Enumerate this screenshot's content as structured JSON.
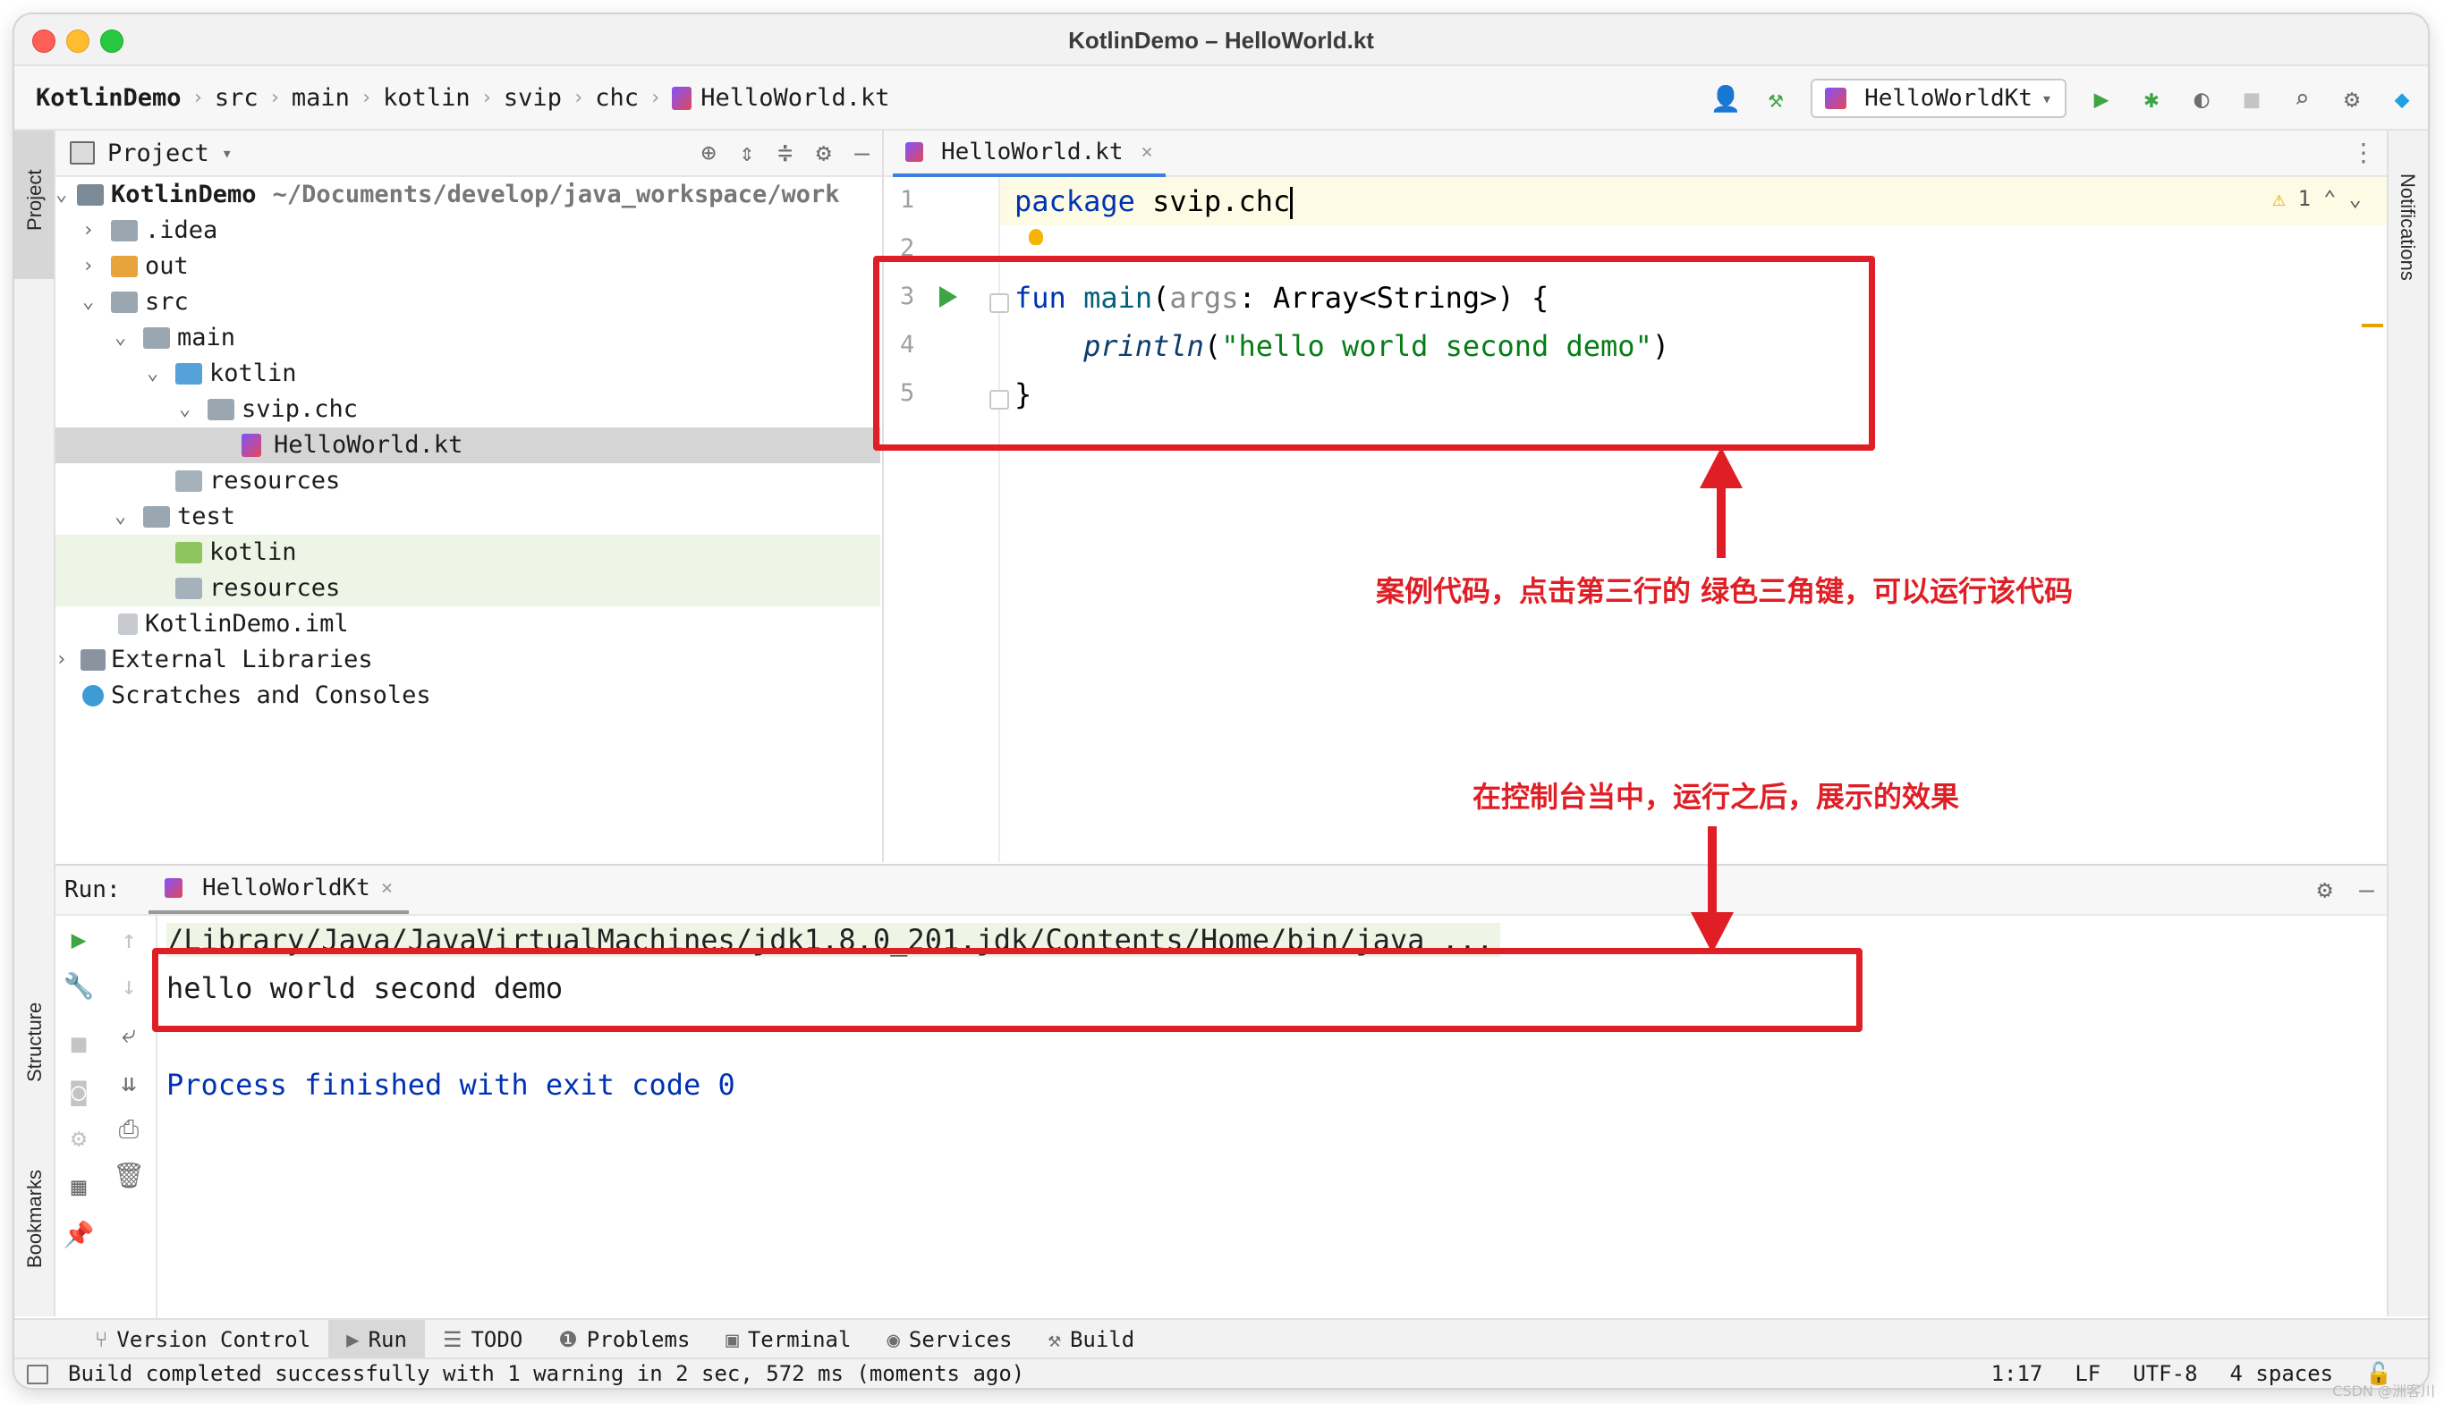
{
  "window": {
    "title": "KotlinDemo – HelloWorld.kt"
  },
  "breadcrumbs": [
    "KotlinDemo",
    "src",
    "main",
    "kotlin",
    "svip",
    "chc",
    "HelloWorld.kt"
  ],
  "toolbar": {
    "run_config": "HelloWorldKt"
  },
  "left_strip": {
    "project": "Project",
    "structure": "Structure",
    "bookmarks": "Bookmarks"
  },
  "right_strip": {
    "notifications": "Notifications"
  },
  "project_panel": {
    "title": "Project",
    "tree": [
      {
        "label": "KotlinDemo",
        "path": "~/Documents/develop/java_workspace/work"
      },
      {
        "label": ".idea"
      },
      {
        "label": "out"
      },
      {
        "label": "src"
      },
      {
        "label": "main"
      },
      {
        "label": "kotlin"
      },
      {
        "label": "svip.chc"
      },
      {
        "label": "HelloWorld.kt"
      },
      {
        "label": "resources"
      },
      {
        "label": "test"
      },
      {
        "label": "kotlin"
      },
      {
        "label": "resources"
      },
      {
        "label": "KotlinDemo.iml"
      },
      {
        "label": "External Libraries"
      },
      {
        "label": "Scratches and Consoles"
      }
    ]
  },
  "editor": {
    "tab": "HelloWorld.kt",
    "warnings": "1",
    "line_numbers": [
      "1",
      "2",
      "3",
      "4",
      "5"
    ],
    "code": {
      "l1_kw": "package",
      "l1_rest": " svip.chc",
      "l3_kw": "fun",
      "l3_name": " main",
      "l3_open": "(",
      "l3_param": "args",
      "l3_rest": ": Array<String>) {",
      "l4_indent": "    ",
      "l4_fn": "println",
      "l4_open": "(",
      "l4_str": "\"hello world second demo\"",
      "l4_close": ")",
      "l5": "}"
    }
  },
  "annotations": {
    "top": "案例代码，点击第三行的 绿色三角键，可以运行该代码",
    "bottom": "在控制台当中，运行之后，展示的效果"
  },
  "run_panel": {
    "label": "Run:",
    "tab": "HelloWorldKt",
    "console": {
      "cmd": "/Library/Java/JavaVirtualMachines/jdk1.8.0_201.jdk/Contents/Home/bin/java ...",
      "output": "hello world second demo",
      "exit": "Process finished with exit code 0"
    }
  },
  "bottom_tools": [
    {
      "label": "Version Control"
    },
    {
      "label": "Run"
    },
    {
      "label": "TODO"
    },
    {
      "label": "Problems"
    },
    {
      "label": "Terminal"
    },
    {
      "label": "Services"
    },
    {
      "label": "Build"
    }
  ],
  "status": {
    "message": "Build completed successfully with 1 warning in 2 sec, 572 ms (moments ago)",
    "position": "1:17",
    "line_sep": "LF",
    "encoding": "UTF-8",
    "indent": "4 spaces"
  },
  "watermark": "CSDN @洲客川",
  "icons": [
    "run-icon",
    "debug-icon",
    "coverage-icon",
    "stop-icon",
    "search-icon",
    "gear-icon",
    "build-hammer-icon",
    "user-icon",
    "locate-icon",
    "expand-icon",
    "collapse-icon",
    "minimize-icon",
    "lightbulb-icon",
    "warning-icon",
    "rerun-icon",
    "wrench-icon",
    "camera-icon",
    "wrap-icon",
    "scroll-end-icon",
    "print-icon",
    "trash-icon",
    "pin-icon",
    "layout-icon"
  ],
  "colors": {
    "accent": "#3d7fe0",
    "annotation": "#e01e25",
    "keyword": "#0033b3",
    "string": "#067d17",
    "run_green": "#3ea544"
  }
}
